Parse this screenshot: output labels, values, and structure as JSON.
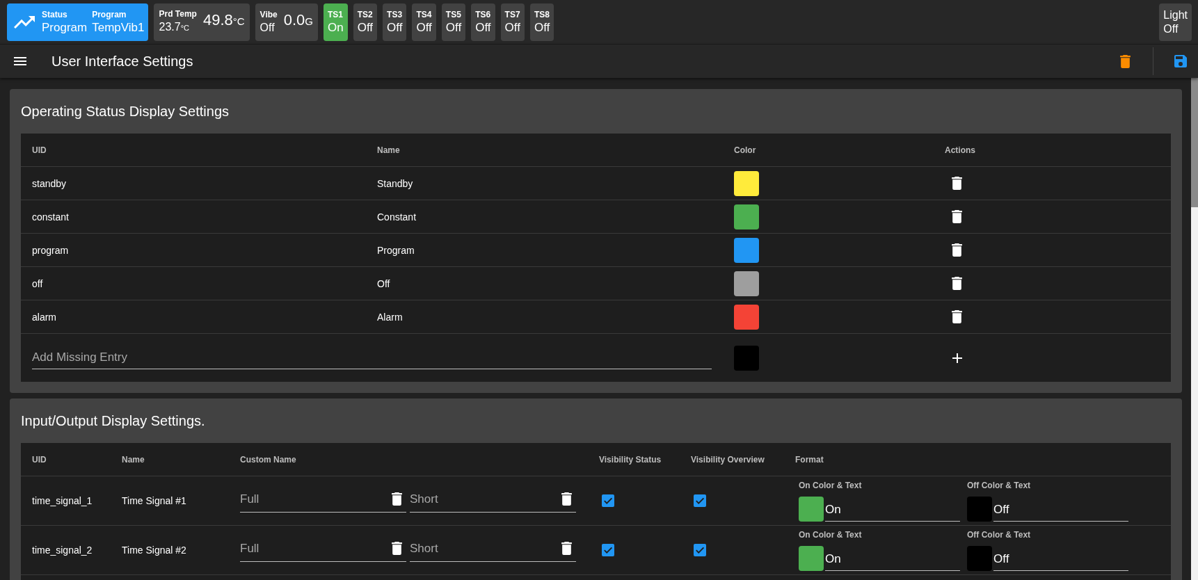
{
  "top_bar": {
    "status_tile": {
      "fields": [
        {
          "label": "Status",
          "value": "Program"
        },
        {
          "label": "Program",
          "value": "TempVib1"
        }
      ]
    },
    "readings": [
      {
        "label": "Prd Temp",
        "secondary": "23.7",
        "secondary_unit": "°C",
        "value": "49.8",
        "unit": "°C"
      },
      {
        "label": "Vibe",
        "secondary": "Off",
        "value": "0.0",
        "unit": "G"
      }
    ],
    "signals": [
      {
        "label": "TS1",
        "value": "On",
        "on": true
      },
      {
        "label": "TS2",
        "value": "Off",
        "on": false
      },
      {
        "label": "TS3",
        "value": "Off",
        "on": false
      },
      {
        "label": "TS4",
        "value": "Off",
        "on": false
      },
      {
        "label": "TS5",
        "value": "Off",
        "on": false
      },
      {
        "label": "TS6",
        "value": "Off",
        "on": false
      },
      {
        "label": "TS7",
        "value": "Off",
        "on": false
      },
      {
        "label": "TS8",
        "value": "Off",
        "on": false
      }
    ],
    "light": {
      "label": "Light",
      "value": "Off",
      "on": false
    }
  },
  "toolbar": {
    "title": "User Interface Settings"
  },
  "status_settings": {
    "title": "Operating Status Display Settings",
    "columns": [
      "UID",
      "Name",
      "Color",
      "Actions"
    ],
    "rows": [
      {
        "uid": "standby",
        "name": "Standby",
        "color": "#ffeb3b"
      },
      {
        "uid": "constant",
        "name": "Constant",
        "color": "#4caf50"
      },
      {
        "uid": "program",
        "name": "Program",
        "color": "#2196f3"
      },
      {
        "uid": "off",
        "name": "Off",
        "color": "#9e9e9e"
      },
      {
        "uid": "alarm",
        "name": "Alarm",
        "color": "#f44336"
      }
    ],
    "new_entry": {
      "placeholder": "Add Missing Entry",
      "color": "#000000"
    }
  },
  "io_settings": {
    "title": "Input/Output Display Settings.",
    "columns": [
      "UID",
      "Name",
      "Custom Name",
      "Visibility Status",
      "Visibility Overview",
      "Format"
    ],
    "rows": [
      {
        "uid": "time_signal_1",
        "name": "Time Signal #1",
        "custom_fields": [
          {
            "placeholder": "Full"
          },
          {
            "placeholder": "Short"
          }
        ],
        "visibility_status": true,
        "visibility_overview": true,
        "formats": [
          {
            "label": "On Color & Text",
            "color": "#4caf50",
            "text": "On"
          },
          {
            "label": "Off Color & Text",
            "color": "#000000",
            "text": "Off"
          }
        ]
      },
      {
        "uid": "time_signal_2",
        "name": "Time Signal #2",
        "custom_fields": [
          {
            "placeholder": "Full"
          },
          {
            "placeholder": "Short"
          }
        ],
        "visibility_status": true,
        "visibility_overview": true,
        "formats": [
          {
            "label": "On Color & Text",
            "color": "#4caf50",
            "text": "On"
          },
          {
            "label": "Off Color & Text",
            "color": "#000000",
            "text": "Off"
          }
        ]
      }
    ]
  }
}
